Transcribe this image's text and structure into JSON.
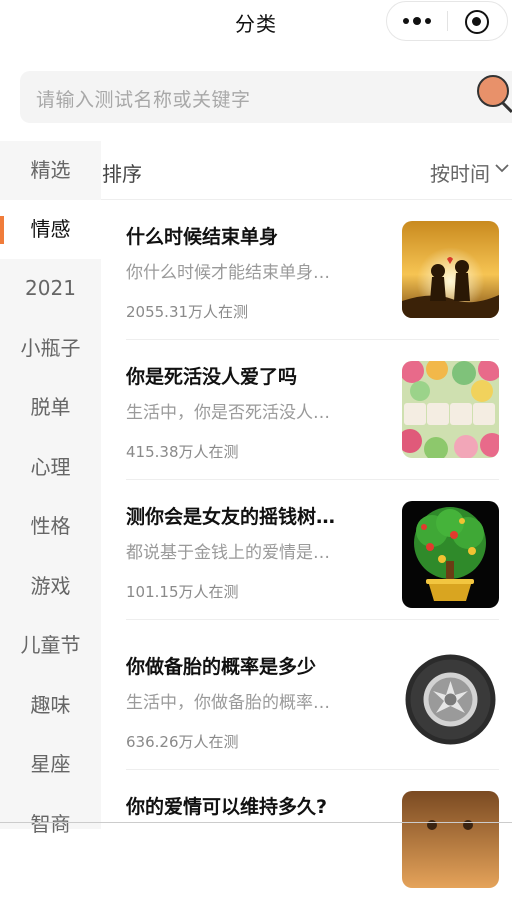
{
  "navbar": {
    "title": "分类"
  },
  "search": {
    "placeholder": "请输入测试名称或关键字"
  },
  "sidebar": {
    "items": [
      {
        "label": "精选",
        "active": false
      },
      {
        "label": "情感",
        "active": true
      },
      {
        "label": "2021",
        "active": false
      },
      {
        "label": "小瓶子",
        "active": false
      },
      {
        "label": "脱单",
        "active": false
      },
      {
        "label": "心理",
        "active": false
      },
      {
        "label": "性格",
        "active": false
      },
      {
        "label": "游戏",
        "active": false
      },
      {
        "label": "儿童节",
        "active": false
      },
      {
        "label": "趣味",
        "active": false
      },
      {
        "label": "星座",
        "active": false
      },
      {
        "label": "智商",
        "active": false
      }
    ]
  },
  "sort": {
    "label": "排序",
    "value": "按时间"
  },
  "items": [
    {
      "title": "什么时候结束单身",
      "desc": "你什么时候才能结束单身…",
      "count": "2055.31万人在测",
      "thumb": "sunset-couple"
    },
    {
      "title": "你是死活没人爱了吗",
      "desc": "生活中，你是否死活没人…",
      "count": "415.38万人在测",
      "thumb": "love-candy"
    },
    {
      "title": "测你会是女友的摇钱树…",
      "desc": "都说基于金钱上的爱情是…",
      "count": "101.15万人在测",
      "thumb": "money-tree"
    },
    {
      "title": "你做备胎的概率是多少",
      "desc": "生活中，你做备胎的概率…",
      "count": "636.26万人在测",
      "thumb": "spare-tire"
    },
    {
      "title": "你的爱情可以维持多久?",
      "desc": "",
      "count": "",
      "thumb": "couple-landscape"
    }
  ],
  "colors": {
    "accent": "#f07c3a",
    "sidebar_bg": "#f6f6f6",
    "search_bg": "#f4f4f4"
  }
}
